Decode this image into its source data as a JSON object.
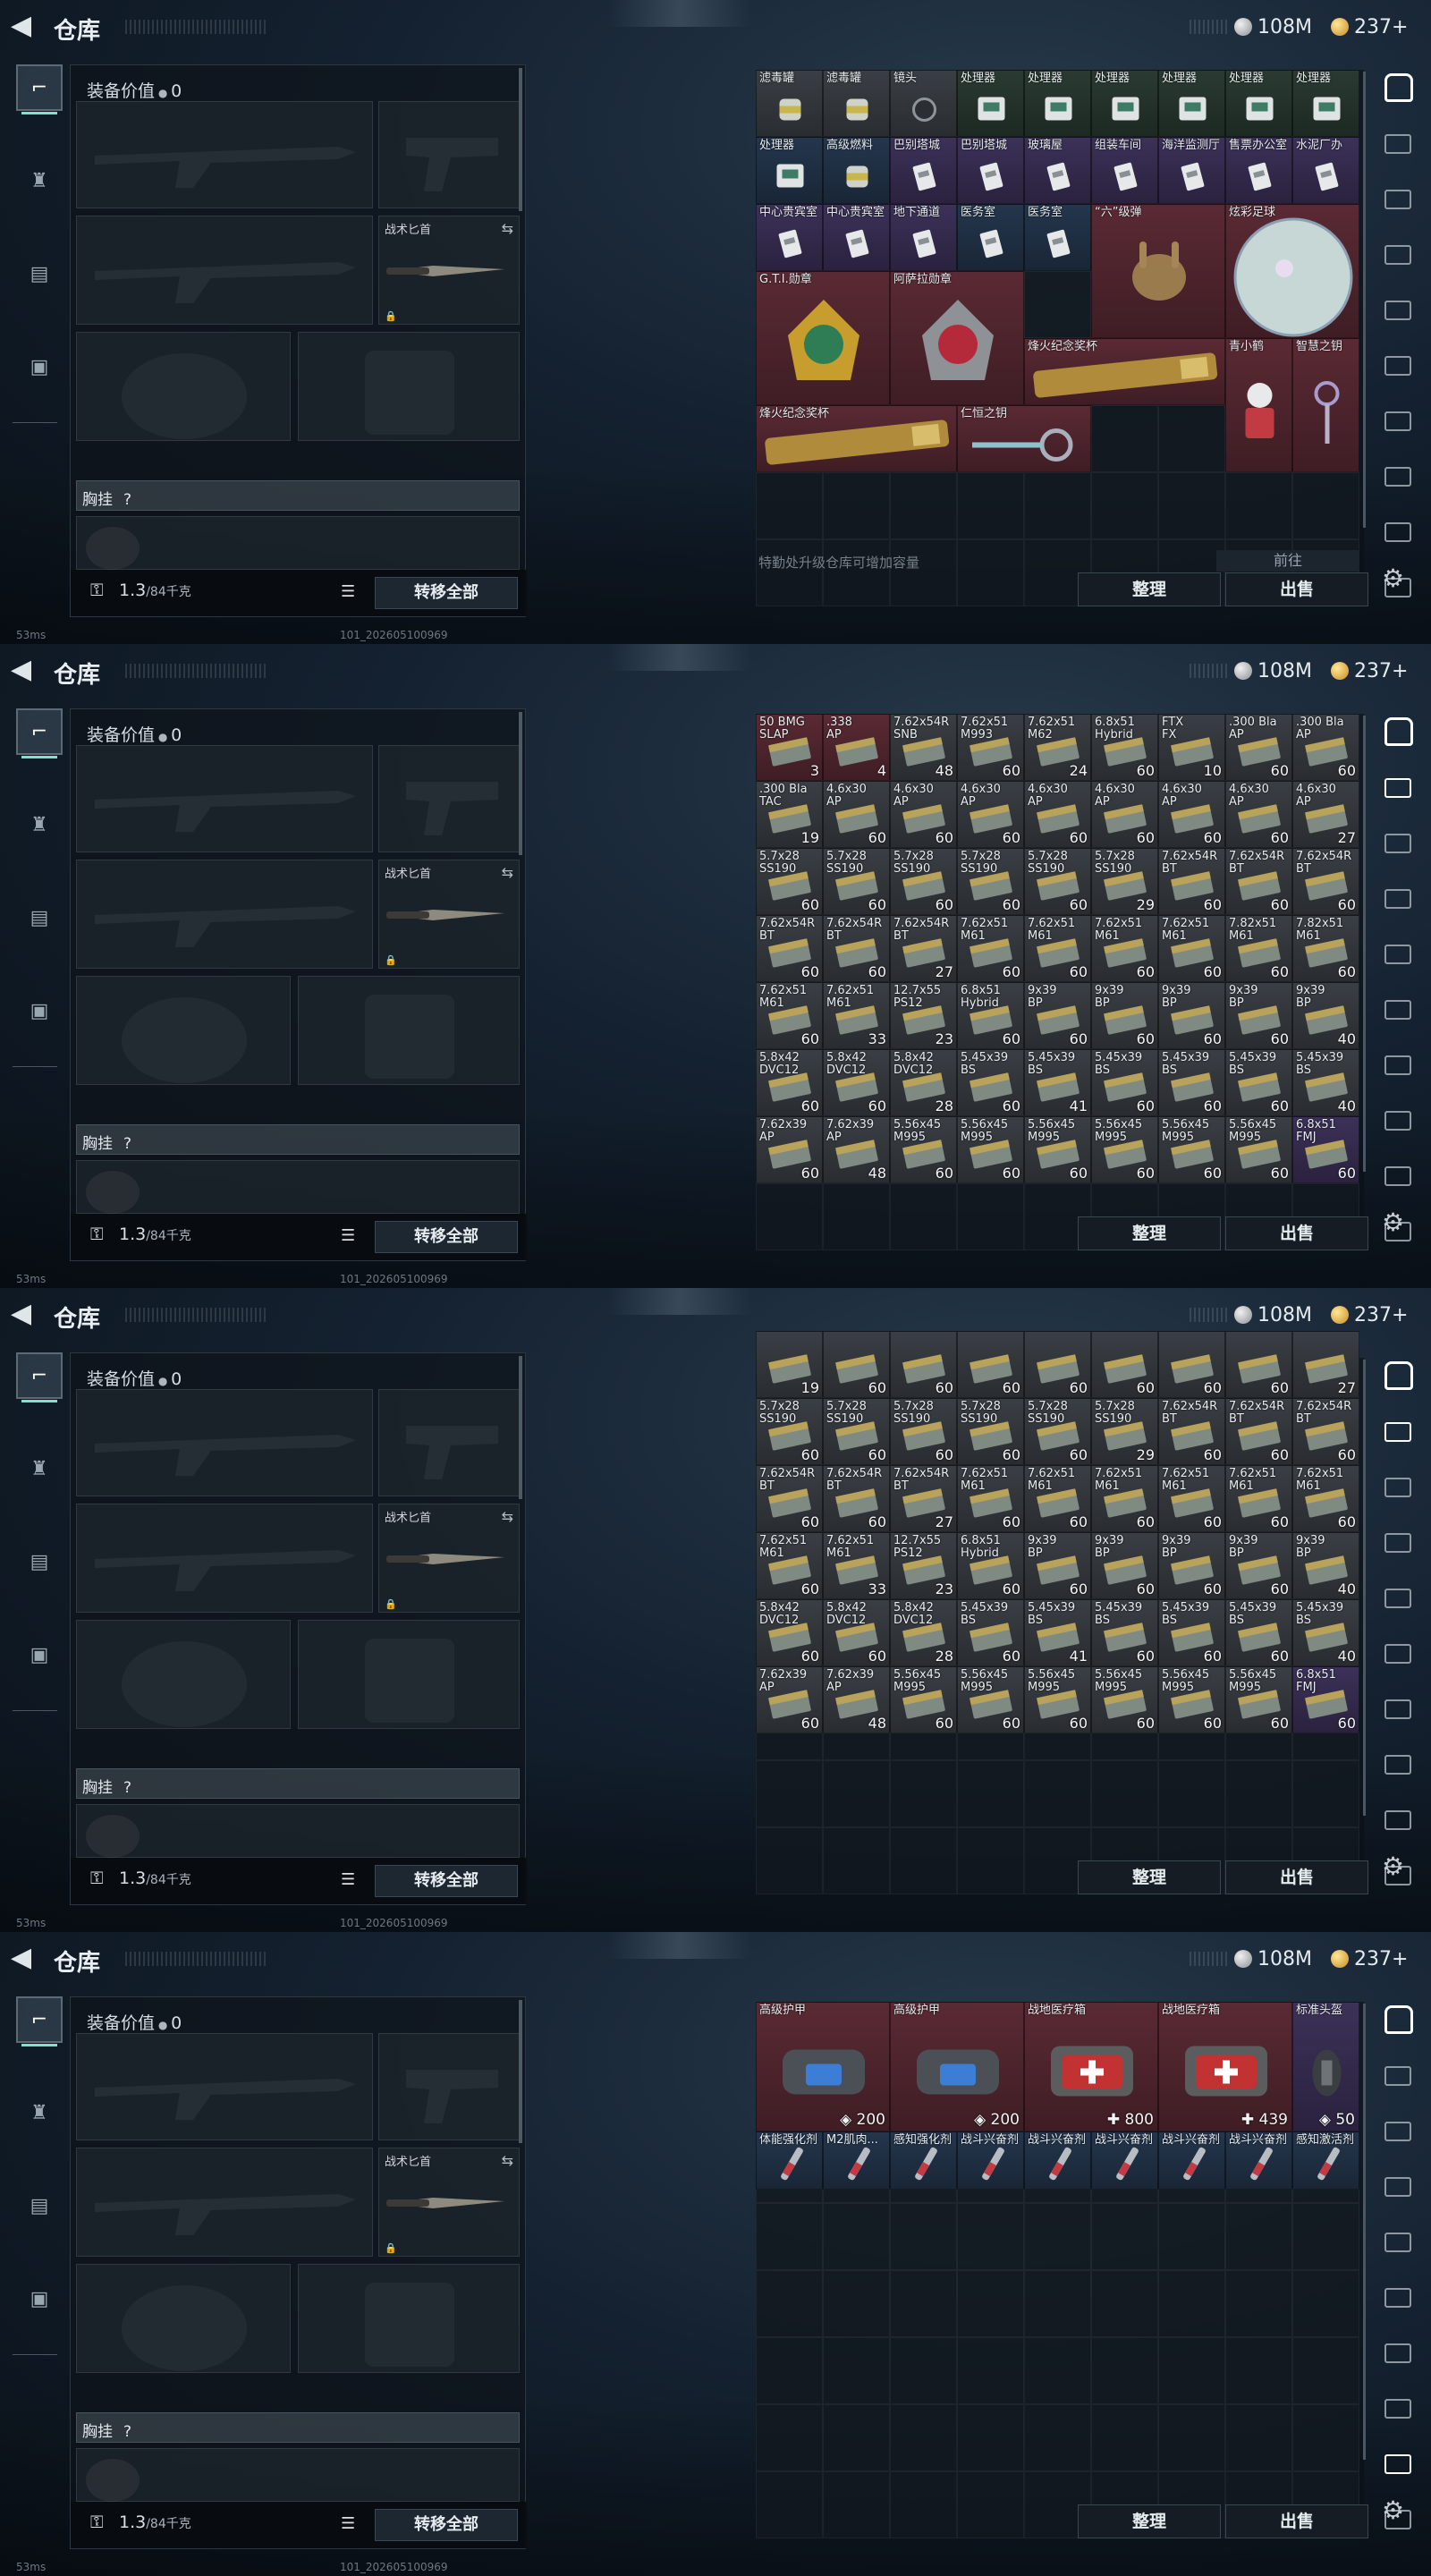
{
  "header": {
    "title": "仓库",
    "currency_silver": "108M",
    "currency_gold": "237+",
    "back_icon": "back-arrow-icon"
  },
  "colors": {
    "accent": "#7ee2c8",
    "rarity_red": "#5a2a34",
    "rarity_gold": "#5e4a2a",
    "rarity_purple": "#3c3158",
    "rarity_blue": "#24364d",
    "rarity_green": "#2a3a32",
    "rarity_gray": "#3a3f45"
  },
  "loadout": {
    "value_label": "装备价值",
    "value_amount": "0",
    "melee_label": "战术匕首",
    "chest_label": "胸挂",
    "chest_help": "?",
    "weight": "1.3",
    "weight_max": "/84千克",
    "transfer_button": "转移全部"
  },
  "storage": {
    "tip": "特勤处升级仓库可增加容量",
    "go_button": "前往",
    "sort_button": "整理",
    "sell_button": "出售"
  },
  "status": {
    "ping": "53ms",
    "build": "101_202605100969"
  },
  "panels": [
    {
      "scroll_offset": 0,
      "empty_rows": 2,
      "show_tip": true,
      "items": [
        {
          "name": "滤毒罐",
          "rar": "rarity_gray",
          "icon": "can"
        },
        {
          "name": "滤毒罐",
          "rar": "rarity_gray",
          "icon": "can"
        },
        {
          "name": "镜头",
          "rar": "rarity_gray",
          "icon": "lens"
        },
        {
          "name": "处理器",
          "rar": "rarity_green",
          "icon": "chip"
        },
        {
          "name": "处理器",
          "rar": "rarity_green",
          "icon": "chip"
        },
        {
          "name": "处理器",
          "rar": "rarity_green",
          "icon": "chip"
        },
        {
          "name": "处理器",
          "rar": "rarity_green",
          "icon": "chip"
        },
        {
          "name": "处理器",
          "rar": "rarity_green",
          "icon": "chip"
        },
        {
          "name": "处理器",
          "rar": "rarity_green",
          "icon": "chip"
        },
        {
          "name": "处理器",
          "rar": "rarity_blue",
          "icon": "chip"
        },
        {
          "name": "高级燃料",
          "rar": "rarity_blue",
          "icon": "can"
        },
        {
          "name": "巴别塔城",
          "rar": "rarity_purple",
          "icon": "card"
        },
        {
          "name": "巴别塔城",
          "rar": "rarity_purple",
          "icon": "card"
        },
        {
          "name": "玻璃屋",
          "rar": "rarity_purple",
          "icon": "card"
        },
        {
          "name": "组装车间",
          "rar": "rarity_purple",
          "icon": "card"
        },
        {
          "name": "海洋监测厅",
          "rar": "rarity_purple",
          "icon": "card"
        },
        {
          "name": "售票办公室",
          "rar": "rarity_purple",
          "icon": "card"
        },
        {
          "name": "水泥厂办",
          "rar": "rarity_purple",
          "icon": "card"
        },
        {
          "name": "中心贵宾室",
          "rar": "rarity_purple",
          "icon": "card"
        },
        {
          "name": "中心贵宾室",
          "rar": "rarity_purple",
          "icon": "card"
        },
        {
          "name": "地下通道",
          "rar": "rarity_purple",
          "icon": "card"
        },
        {
          "name": "医务室",
          "rar": "rarity_blue",
          "icon": "card"
        },
        {
          "name": "医务室",
          "rar": "rarity_blue",
          "icon": "card"
        },
        {
          "name": "“六”级弹",
          "rar": "rarity_red",
          "icon": "hand"
        },
        {
          "name": "炫彩足球",
          "rar": "rarity_red",
          "icon": "ball"
        },
        {
          "name": "G.T.I.勋章",
          "rar": "rarity_red",
          "icon": "medal"
        },
        {
          "name": "阿萨拉勋章",
          "rar": "rarity_red",
          "icon": "medal2"
        },
        {
          "name": "烽火纪念奖杯",
          "rar": "rarity_red",
          "icon": "trophy"
        },
        {
          "name": "青小鹤",
          "rar": "rarity_red",
          "icon": "bust"
        },
        {
          "name": "智慧之钥",
          "rar": "rarity_red",
          "icon": "key"
        },
        {
          "name": "烽火纪念奖杯",
          "rar": "rarity_red",
          "icon": "trophy"
        },
        {
          "name": "仁恒之钥",
          "rar": "rarity_red",
          "icon": "key2"
        }
      ]
    },
    {
      "scroll_offset": 0,
      "empty_rows": 0,
      "show_tip": false,
      "ammo_rows": [
        [
          [
            "50 BMG",
            "SLAP",
            "3",
            "rarity_red"
          ],
          [
            ".338",
            "AP",
            "4",
            "rarity_red"
          ],
          [
            "7.62x54R",
            "SNB",
            "48",
            "rarity_gray"
          ],
          [
            "7.62x51",
            "M993",
            "60",
            "rarity_gray"
          ],
          [
            "7.62x51",
            "M62",
            "24",
            "rarity_gray"
          ],
          [
            "6.8x51",
            "Hybrid",
            "60",
            "rarity_gray"
          ],
          [
            "FTX",
            "FX",
            "10",
            "rarity_gray"
          ],
          [
            ".300 Bla",
            "AP",
            "60",
            "rarity_gray"
          ],
          [
            ".300 Bla",
            "AP",
            "60",
            "rarity_gray"
          ]
        ],
        [
          [
            ".300 Bla",
            "TAC",
            "19",
            "rarity_gray"
          ],
          [
            "4.6x30",
            "AP",
            "60",
            "rarity_gray"
          ],
          [
            "4.6x30",
            "AP",
            "60",
            "rarity_gray"
          ],
          [
            "4.6x30",
            "AP",
            "60",
            "rarity_gray"
          ],
          [
            "4.6x30",
            "AP",
            "60",
            "rarity_gray"
          ],
          [
            "4.6x30",
            "AP",
            "60",
            "rarity_gray"
          ],
          [
            "4.6x30",
            "AP",
            "60",
            "rarity_gray"
          ],
          [
            "4.6x30",
            "AP",
            "60",
            "rarity_gray"
          ],
          [
            "4.6x30",
            "AP",
            "27",
            "rarity_gray"
          ]
        ],
        [
          [
            "5.7x28",
            "SS190",
            "60",
            "rarity_gray"
          ],
          [
            "5.7x28",
            "SS190",
            "60",
            "rarity_gray"
          ],
          [
            "5.7x28",
            "SS190",
            "60",
            "rarity_gray"
          ],
          [
            "5.7x28",
            "SS190",
            "60",
            "rarity_gray"
          ],
          [
            "5.7x28",
            "SS190",
            "60",
            "rarity_gray"
          ],
          [
            "5.7x28",
            "SS190",
            "29",
            "rarity_gray"
          ],
          [
            "7.62x54R",
            "BT",
            "60",
            "rarity_gray"
          ],
          [
            "7.62x54R",
            "BT",
            "60",
            "rarity_gray"
          ],
          [
            "7.62x54R",
            "BT",
            "60",
            "rarity_gray"
          ]
        ],
        [
          [
            "7.62x54R",
            "BT",
            "60",
            "rarity_gray"
          ],
          [
            "7.62x54R",
            "BT",
            "60",
            "rarity_gray"
          ],
          [
            "7.62x54R",
            "BT",
            "27",
            "rarity_gray"
          ],
          [
            "7.62x51",
            "M61",
            "60",
            "rarity_gray"
          ],
          [
            "7.62x51",
            "M61",
            "60",
            "rarity_gray"
          ],
          [
            "7.62x51",
            "M61",
            "60",
            "rarity_gray"
          ],
          [
            "7.62x51",
            "M61",
            "60",
            "rarity_gray"
          ],
          [
            "7.82x51",
            "M61",
            "60",
            "rarity_gray"
          ],
          [
            "7.82x51",
            "M61",
            "60",
            "rarity_gray"
          ]
        ],
        [
          [
            "7.62x51",
            "M61",
            "60",
            "rarity_gray"
          ],
          [
            "7.62x51",
            "M61",
            "33",
            "rarity_gray"
          ],
          [
            "12.7x55",
            "PS12",
            "23",
            "rarity_gray"
          ],
          [
            "6.8x51",
            "Hybrid",
            "60",
            "rarity_gray"
          ],
          [
            "9x39",
            "BP",
            "60",
            "rarity_gray"
          ],
          [
            "9x39",
            "BP",
            "60",
            "rarity_gray"
          ],
          [
            "9x39",
            "BP",
            "60",
            "rarity_gray"
          ],
          [
            "9x39",
            "BP",
            "60",
            "rarity_gray"
          ],
          [
            "9x39",
            "BP",
            "40",
            "rarity_gray"
          ]
        ],
        [
          [
            "5.8x42",
            "DVC12",
            "60",
            "rarity_gray"
          ],
          [
            "5.8x42",
            "DVC12",
            "60",
            "rarity_gray"
          ],
          [
            "5.8x42",
            "DVC12",
            "28",
            "rarity_gray"
          ],
          [
            "5.45x39",
            "BS",
            "60",
            "rarity_gray"
          ],
          [
            "5.45x39",
            "BS",
            "41",
            "rarity_gray"
          ],
          [
            "5.45x39",
            "BS",
            "60",
            "rarity_gray"
          ],
          [
            "5.45x39",
            "BS",
            "60",
            "rarity_gray"
          ],
          [
            "5.45x39",
            "BS",
            "60",
            "rarity_gray"
          ],
          [
            "5.45x39",
            "BS",
            "40",
            "rarity_gray"
          ]
        ],
        [
          [
            "7.62x39",
            "AP",
            "60",
            "rarity_gray"
          ],
          [
            "7.62x39",
            "AP",
            "48",
            "rarity_gray"
          ],
          [
            "5.56x45",
            "M995",
            "60",
            "rarity_gray"
          ],
          [
            "5.56x45",
            "M995",
            "60",
            "rarity_gray"
          ],
          [
            "5.56x45",
            "M995",
            "60",
            "rarity_gray"
          ],
          [
            "5.56x45",
            "M995",
            "60",
            "rarity_gray"
          ],
          [
            "5.56x45",
            "M995",
            "60",
            "rarity_gray"
          ],
          [
            "5.56x45",
            "M995",
            "60",
            "rarity_gray"
          ],
          [
            "6.8x51",
            "FMJ",
            "60",
            "rarity_purple"
          ]
        ]
      ]
    },
    {
      "scroll_offset": 1,
      "empty_rows": 1,
      "show_tip": false,
      "ammo_rows": [
        [
          [
            "",
            "",
            "19",
            "rarity_gray"
          ],
          [
            "",
            "",
            "60",
            "rarity_gray"
          ],
          [
            "",
            "",
            "60",
            "rarity_gray"
          ],
          [
            "",
            "",
            "60",
            "rarity_gray"
          ],
          [
            "",
            "",
            "60",
            "rarity_gray"
          ],
          [
            "",
            "",
            "60",
            "rarity_gray"
          ],
          [
            "",
            "",
            "60",
            "rarity_gray"
          ],
          [
            "",
            "",
            "60",
            "rarity_gray"
          ],
          [
            "",
            "",
            "27",
            "rarity_gray"
          ]
        ],
        [
          [
            "5.7x28",
            "SS190",
            "60",
            "rarity_gray"
          ],
          [
            "5.7x28",
            "SS190",
            "60",
            "rarity_gray"
          ],
          [
            "5.7x28",
            "SS190",
            "60",
            "rarity_gray"
          ],
          [
            "5.7x28",
            "SS190",
            "60",
            "rarity_gray"
          ],
          [
            "5.7x28",
            "SS190",
            "60",
            "rarity_gray"
          ],
          [
            "5.7x28",
            "SS190",
            "29",
            "rarity_gray"
          ],
          [
            "7.62x54R",
            "BT",
            "60",
            "rarity_gray"
          ],
          [
            "7.62x54R",
            "BT",
            "60",
            "rarity_gray"
          ],
          [
            "7.62x54R",
            "BT",
            "60",
            "rarity_gray"
          ]
        ],
        [
          [
            "7.62x54R",
            "BT",
            "60",
            "rarity_gray"
          ],
          [
            "7.62x54R",
            "BT",
            "60",
            "rarity_gray"
          ],
          [
            "7.62x54R",
            "BT",
            "27",
            "rarity_gray"
          ],
          [
            "7.62x51",
            "M61",
            "60",
            "rarity_gray"
          ],
          [
            "7.62x51",
            "M61",
            "60",
            "rarity_gray"
          ],
          [
            "7.62x51",
            "M61",
            "60",
            "rarity_gray"
          ],
          [
            "7.62x51",
            "M61",
            "60",
            "rarity_gray"
          ],
          [
            "7.62x51",
            "M61",
            "60",
            "rarity_gray"
          ],
          [
            "7.62x51",
            "M61",
            "60",
            "rarity_gray"
          ]
        ],
        [
          [
            "7.62x51",
            "M61",
            "60",
            "rarity_gray"
          ],
          [
            "7.62x51",
            "M61",
            "33",
            "rarity_gray"
          ],
          [
            "12.7x55",
            "PS12",
            "23",
            "rarity_gray"
          ],
          [
            "6.8x51",
            "Hybrid",
            "60",
            "rarity_gray"
          ],
          [
            "9x39",
            "BP",
            "60",
            "rarity_gray"
          ],
          [
            "9x39",
            "BP",
            "60",
            "rarity_gray"
          ],
          [
            "9x39",
            "BP",
            "60",
            "rarity_gray"
          ],
          [
            "9x39",
            "BP",
            "60",
            "rarity_gray"
          ],
          [
            "9x39",
            "BP",
            "40",
            "rarity_gray"
          ]
        ],
        [
          [
            "5.8x42",
            "DVC12",
            "60",
            "rarity_gray"
          ],
          [
            "5.8x42",
            "DVC12",
            "60",
            "rarity_gray"
          ],
          [
            "5.8x42",
            "DVC12",
            "28",
            "rarity_gray"
          ],
          [
            "5.45x39",
            "BS",
            "60",
            "rarity_gray"
          ],
          [
            "5.45x39",
            "BS",
            "41",
            "rarity_gray"
          ],
          [
            "5.45x39",
            "BS",
            "60",
            "rarity_gray"
          ],
          [
            "5.45x39",
            "BS",
            "60",
            "rarity_gray"
          ],
          [
            "5.45x39",
            "BS",
            "60",
            "rarity_gray"
          ],
          [
            "5.45x39",
            "BS",
            "40",
            "rarity_gray"
          ]
        ],
        [
          [
            "7.62x39",
            "AP",
            "60",
            "rarity_gray"
          ],
          [
            "7.62x39",
            "AP",
            "48",
            "rarity_gray"
          ],
          [
            "5.56x45",
            "M995",
            "60",
            "rarity_gray"
          ],
          [
            "5.56x45",
            "M995",
            "60",
            "rarity_gray"
          ],
          [
            "5.56x45",
            "M995",
            "60",
            "rarity_gray"
          ],
          [
            "5.56x45",
            "M995",
            "60",
            "rarity_gray"
          ],
          [
            "5.56x45",
            "M995",
            "60",
            "rarity_gray"
          ],
          [
            "5.56x45",
            "M995",
            "60",
            "rarity_gray"
          ],
          [
            "6.8x51",
            "FMJ",
            "60",
            "rarity_purple"
          ]
        ]
      ]
    },
    {
      "scroll_offset": 0,
      "empty_rows": 5,
      "show_tip": false,
      "gear_items": [
        {
          "name": "高级护甲",
          "val": "200",
          "kind": "shield",
          "rar": "rarity_red",
          "icon": "armor"
        },
        {
          "name": "高级护甲",
          "val": "200",
          "kind": "shield",
          "rar": "rarity_red",
          "icon": "armor"
        },
        {
          "name": "战地医疗箱",
          "val": "800",
          "kind": "plus",
          "rar": "rarity_red",
          "icon": "medkit"
        },
        {
          "name": "战地医疗箱",
          "val": "439",
          "kind": "plus",
          "rar": "rarity_red",
          "icon": "medkit"
        },
        {
          "name": "标准头盔",
          "val": "50",
          "kind": "shield",
          "rar": "rarity_purple",
          "icon": "helmet"
        }
      ],
      "injectors": [
        {
          "name": "体能强化剂",
          "rar": "rarity_blue"
        },
        {
          "name": "M2肌肉...",
          "rar": "rarity_blue"
        },
        {
          "name": "感知强化剂",
          "rar": "rarity_blue"
        },
        {
          "name": "战斗兴奋剂",
          "rar": "rarity_blue"
        },
        {
          "name": "战斗兴奋剂",
          "rar": "rarity_blue"
        },
        {
          "name": "战斗兴奋剂",
          "rar": "rarity_blue"
        },
        {
          "name": "战斗兴奋剂",
          "rar": "rarity_blue"
        },
        {
          "name": "战斗兴奋剂",
          "rar": "rarity_blue"
        },
        {
          "name": "感知激活剂",
          "rar": "rarity_blue"
        }
      ]
    }
  ]
}
